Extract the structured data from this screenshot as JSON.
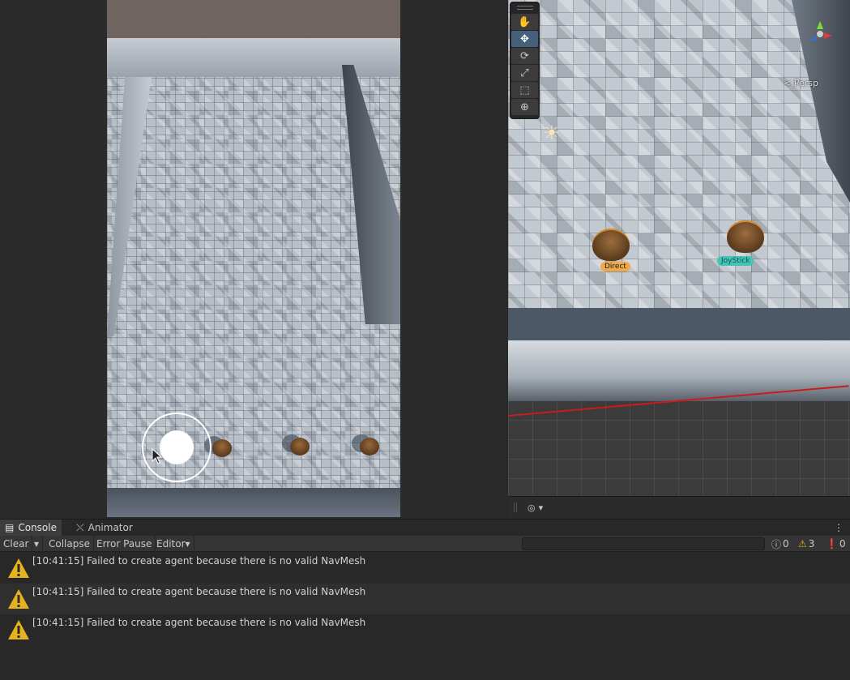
{
  "game_view": {
    "joystick": "joystick",
    "characters": [
      "cowboy",
      "cowboy",
      "cowboy"
    ]
  },
  "scene_view": {
    "tools": [
      "hand",
      "move",
      "rotate",
      "scale",
      "rect",
      "transform"
    ],
    "active_tool": "move",
    "projection_label": "< Persp",
    "characters": [
      {
        "label": "Direct",
        "color": "#f0a94a"
      },
      {
        "label": "JoyStick",
        "color": "#44c3b7"
      }
    ]
  },
  "console": {
    "tabs": [
      {
        "label": "Console"
      },
      {
        "label": "Animator"
      }
    ],
    "toolbar": {
      "clear": "Clear",
      "collapse": "Collapse",
      "error_pause": "Error Pause",
      "editor": "Editor"
    },
    "search": {
      "value": ""
    },
    "counts": {
      "log": "0",
      "warning": "3",
      "error": "0"
    },
    "messages": [
      {
        "text": "[10:41:15] Failed to create agent because there is no valid NavMesh"
      },
      {
        "text": "[10:41:15] Failed to create agent because there is no valid NavMesh"
      },
      {
        "text": "[10:41:15] Failed to create agent because there is no valid NavMesh"
      }
    ]
  },
  "colors": {
    "warning": "#e6b31e",
    "selection_axis": "#c81d1d",
    "active_tool": "#46607c"
  }
}
